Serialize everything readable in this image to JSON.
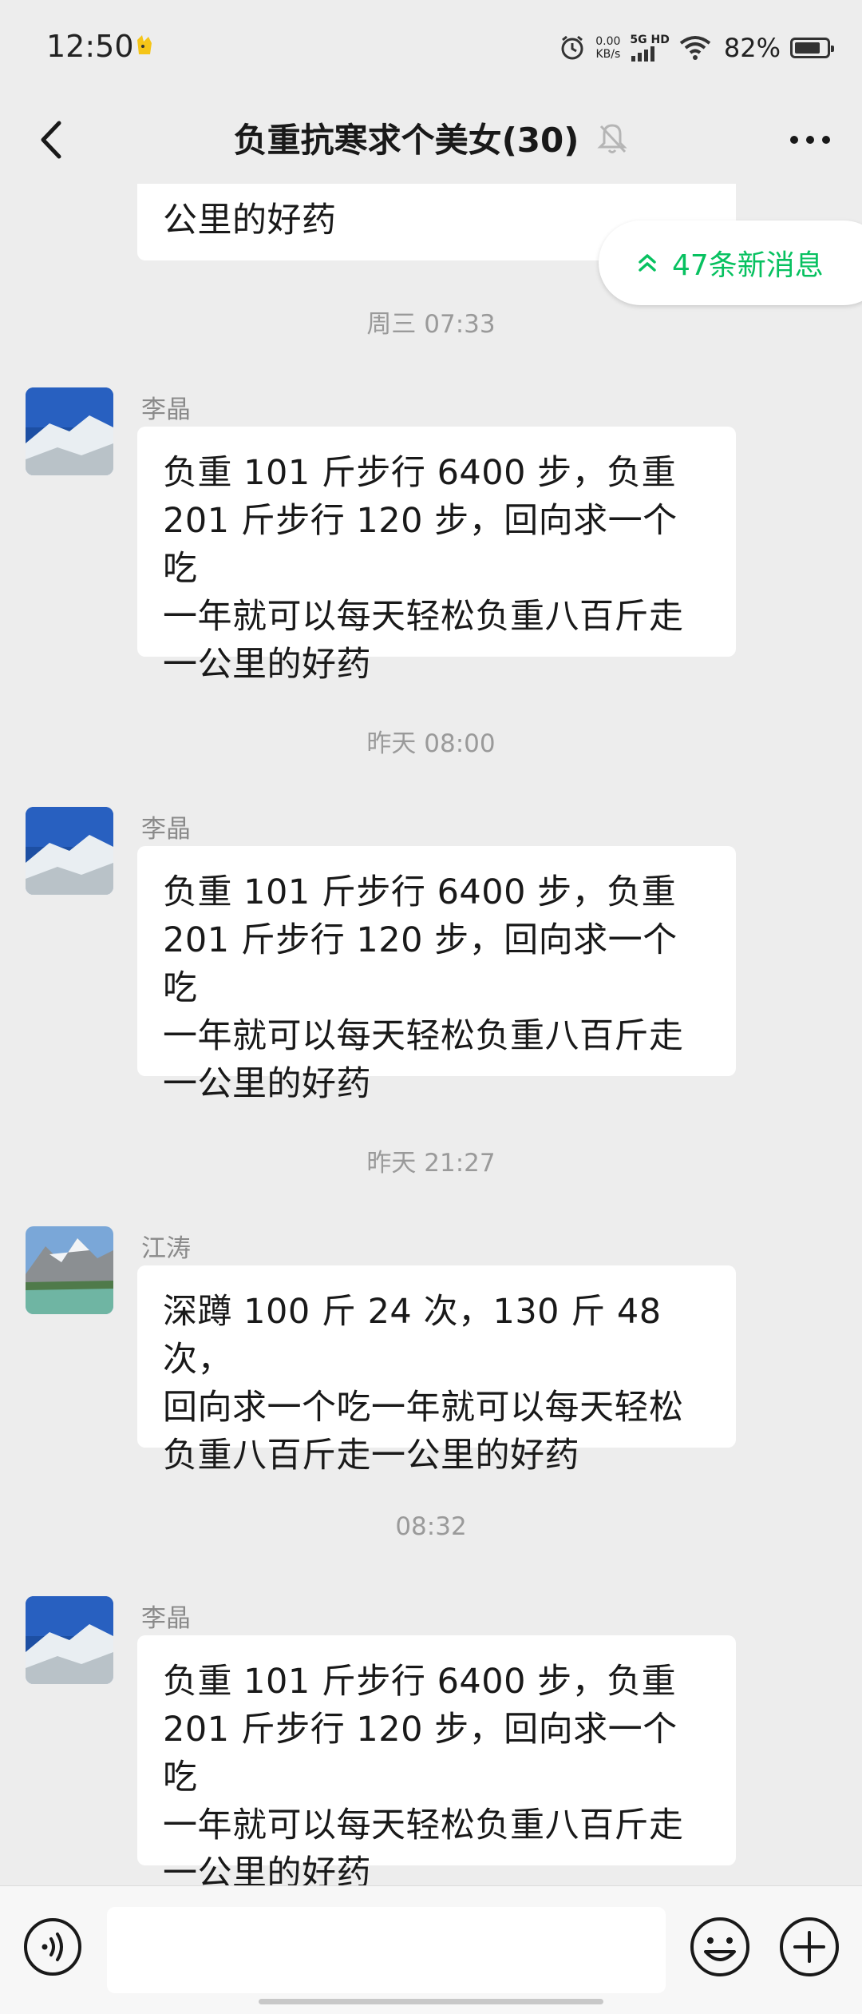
{
  "status_bar": {
    "time": "12:50",
    "speed_value": "0.00",
    "speed_unit": "KB/s",
    "network_label": "5G HD",
    "battery_percent": "82%",
    "battery_level": 0.82
  },
  "nav": {
    "title": "负重抗寒求个美女(30)"
  },
  "new_messages": {
    "label": "47条新消息"
  },
  "messages": [
    {
      "text": "公里的好药"
    },
    {
      "time": "周三 07:33",
      "sender": "李晶",
      "text": "负重 101 斤步行 6400 步，负重\n201 斤步行 120 步，回向求一个吃\n一年就可以每天轻松负重八百斤走\n一公里的好药"
    },
    {
      "time": "昨天 08:00",
      "sender": "李晶",
      "text": "负重 101 斤步行 6400 步，负重\n201 斤步行 120 步，回向求一个吃\n一年就可以每天轻松负重八百斤走\n一公里的好药"
    },
    {
      "time": "昨天 21:27",
      "sender": "江涛",
      "text": "深蹲 100 斤 24 次，130 斤 48 次，\n回向求一个吃一年就可以每天轻松\n负重八百斤走一公里的好药"
    },
    {
      "time": "08:32",
      "sender": "李晶",
      "text": "负重 101 斤步行 6400 步，负重\n201 斤步行 120 步，回向求一个吃\n一年就可以每天轻松负重八百斤走\n一公里的好药"
    }
  ],
  "input": {
    "value": ""
  },
  "colors": {
    "accent_green": "#07c160",
    "background": "#ededed"
  },
  "icons": [
    "back-arrow-icon",
    "mute-bell-icon",
    "more-dots-icon",
    "double-chevron-up-icon",
    "voice-icon",
    "emoji-icon",
    "plus-icon",
    "alarm-icon",
    "wifi-icon",
    "signal-icon",
    "battery-icon"
  ]
}
